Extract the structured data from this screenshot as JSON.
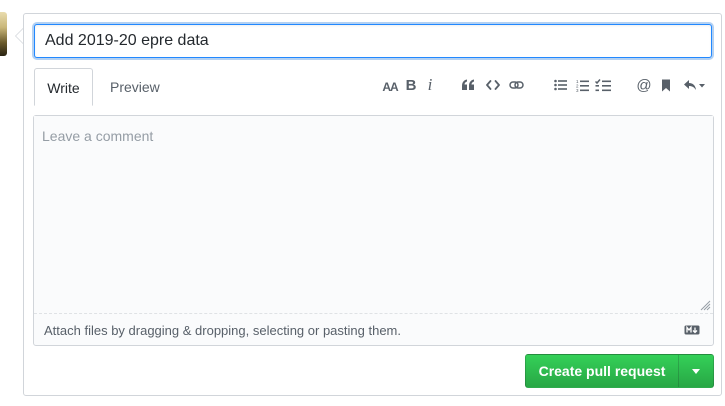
{
  "title_input": {
    "value": "Add 2019-20 epre data"
  },
  "tabs": {
    "write": "Write",
    "preview": "Preview"
  },
  "toolbar": {
    "heading": {
      "icon": "text-size-icon",
      "label": "AA"
    },
    "bold": {
      "icon": "bold-icon",
      "label": "B"
    },
    "italic": {
      "icon": "italic-icon",
      "label": "i"
    },
    "quote": {
      "icon": "quote-icon"
    },
    "code": {
      "icon": "code-icon"
    },
    "link": {
      "icon": "link-icon"
    },
    "unordered_list": {
      "icon": "list-unordered-icon"
    },
    "ordered_list": {
      "icon": "list-ordered-icon"
    },
    "task_list": {
      "icon": "tasklist-icon"
    },
    "mention": {
      "icon": "mention-icon",
      "label": "@"
    },
    "reference": {
      "icon": "bookmark-icon"
    },
    "reply": {
      "icon": "reply-icon"
    }
  },
  "comment": {
    "placeholder": "Leave a comment",
    "attach_hint": "Attach files by dragging & dropping, selecting or pasting them.",
    "markdown_icon": "markdown-icon"
  },
  "submit": {
    "label": "Create pull request",
    "dropdown_icon": "triangle-down-icon"
  },
  "colors": {
    "accent_blue": "#2188ff",
    "button_green": "#28a745",
    "icon_gray": "#586069",
    "border": "#d1d5da"
  }
}
